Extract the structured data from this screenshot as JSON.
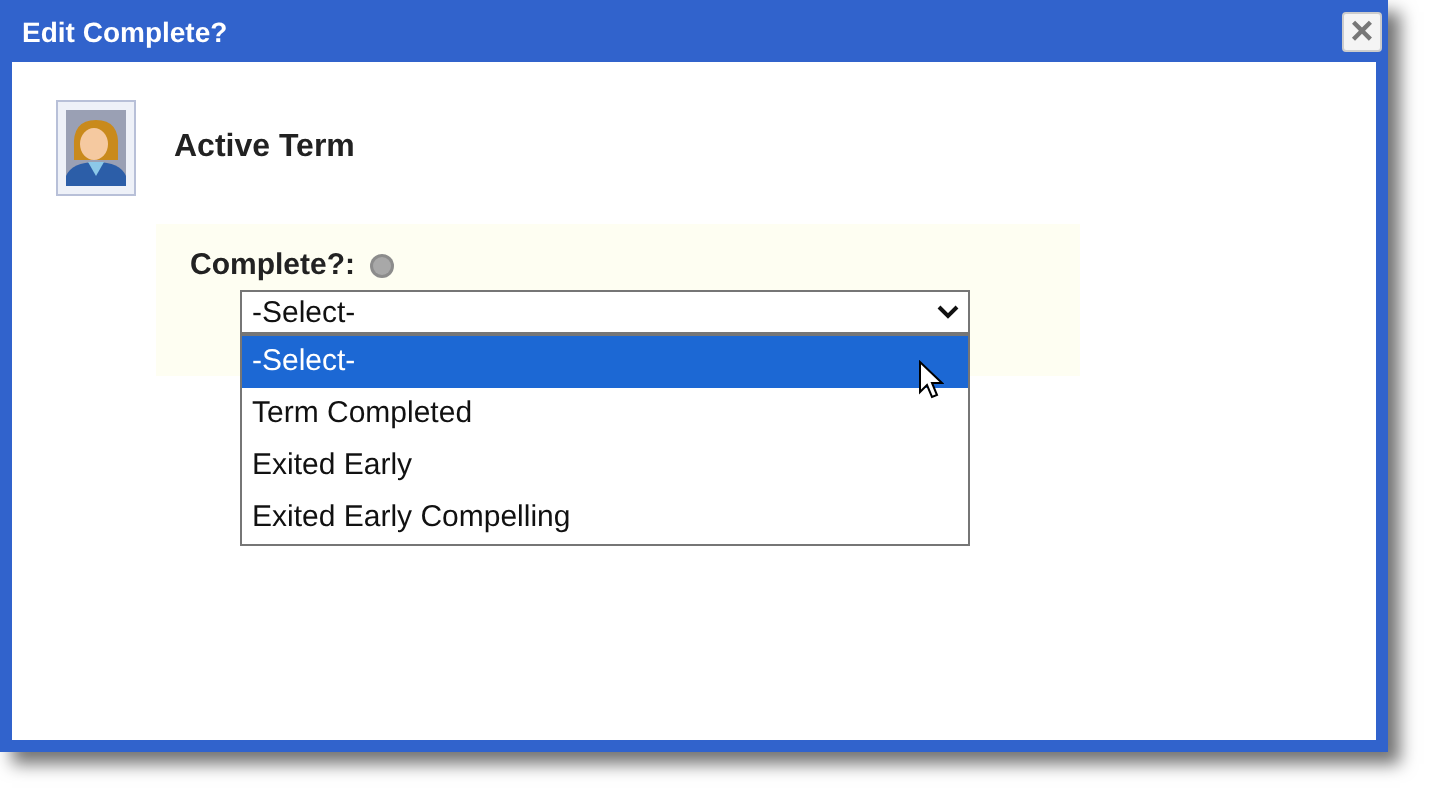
{
  "window": {
    "title": "Edit Complete?",
    "close": "×"
  },
  "header": {
    "title": "Active Term"
  },
  "field": {
    "label": "Complete?:",
    "value": "-Select-",
    "options": [
      {
        "label": "-Select-",
        "selected": true
      },
      {
        "label": "Term Completed",
        "selected": false
      },
      {
        "label": "Exited Early",
        "selected": false
      },
      {
        "label": "Exited Early Compelling",
        "selected": false
      }
    ]
  }
}
